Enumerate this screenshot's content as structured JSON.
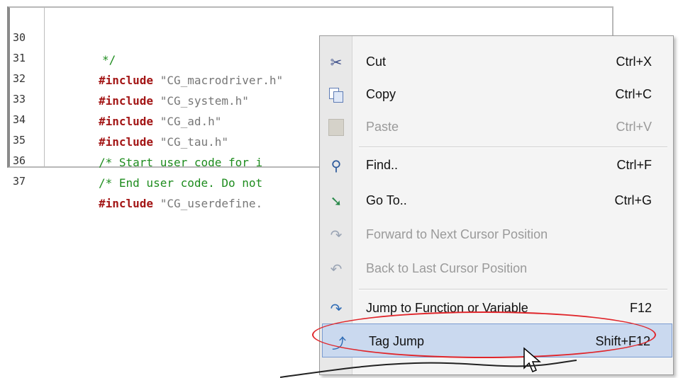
{
  "editor": {
    "lines": [
      {
        "num": "30",
        "kw": "",
        "str": "",
        "comment": "*/"
      },
      {
        "num": "31",
        "kw": "#include",
        "str": " \"CG_macrodriver.h\"",
        "comment": ""
      },
      {
        "num": "32",
        "kw": "#include",
        "str": " \"CG_system.h\"",
        "comment": ""
      },
      {
        "num": "33",
        "kw": "#include",
        "str": " \"CG_ad.h\"",
        "comment": ""
      },
      {
        "num": "34",
        "kw": "#include",
        "str": " \"CG_tau.h\"",
        "comment": ""
      },
      {
        "num": "35",
        "kw": "",
        "str": "",
        "comment": "/* Start user code for i"
      },
      {
        "num": "36",
        "kw": "",
        "str": "",
        "comment": "/* End user code. Do not"
      },
      {
        "num": "37",
        "kw": "#include",
        "str": " \"CG_userdefine.",
        "comment": ""
      }
    ]
  },
  "menu": {
    "items": [
      {
        "icon": "scissors-icon",
        "label": "Cut",
        "shortcut": "Ctrl+X",
        "enabled": true
      },
      {
        "icon": "copy-icon",
        "label": "Copy",
        "shortcut": "Ctrl+C",
        "enabled": true
      },
      {
        "icon": "paste-icon",
        "label": "Paste",
        "shortcut": "Ctrl+V",
        "enabled": false
      },
      {
        "icon": "binoculars-icon",
        "label": "Find..",
        "shortcut": "Ctrl+F",
        "enabled": true
      },
      {
        "icon": "goto-icon",
        "label": "Go To..",
        "shortcut": "Ctrl+G",
        "enabled": true
      },
      {
        "icon": "forward-arrow-icon",
        "label": "Forward to Next Cursor Position",
        "shortcut": "",
        "enabled": false
      },
      {
        "icon": "back-arrow-icon",
        "label": "Back to Last Cursor Position",
        "shortcut": "",
        "enabled": false
      },
      {
        "icon": "jump-arrow-icon",
        "label": "Jump to Function or Variable",
        "shortcut": "F12",
        "enabled": true
      },
      {
        "icon": "tag-jump-icon",
        "label": "Tag Jump",
        "shortcut": "Shift+F12",
        "enabled": true,
        "highlighted": true
      }
    ]
  },
  "colors": {
    "keyword": "#a31515",
    "comment": "#1e8c1e",
    "highlight": "#cad9ef",
    "annotation": "#e0262b"
  }
}
